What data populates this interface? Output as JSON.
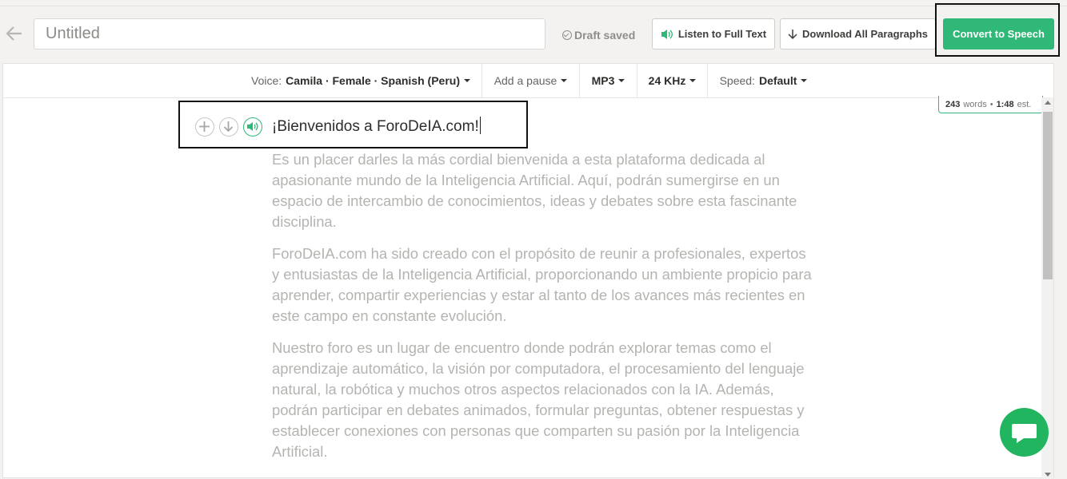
{
  "header": {
    "title_placeholder": "Untitled",
    "draft_status": "Draft saved",
    "listen_label": "Listen to Full Text",
    "download_label": "Download All Paragraphs",
    "convert_label": "Convert to Speech"
  },
  "toolbar": {
    "voice_label": "Voice:",
    "voice_value": "Camila · Female · Spanish (Peru)",
    "pause_label": "Add a pause",
    "format_value": "MP3",
    "rate_value": "24 KHz",
    "speed_label": "Speed:",
    "speed_value": "Default"
  },
  "stats": {
    "words": "243",
    "words_label": "words",
    "separator": "•",
    "duration": "1:48",
    "duration_label": "est."
  },
  "document": {
    "heading": "¡Bienvenidos a ForoDeIA.com!",
    "paragraphs": [
      "Es un placer darles la más cordial bienvenida a esta plataforma dedicada al apasionante mundo de la Inteligencia Artificial. Aquí, podrán sumergirse en un espacio de intercambio de conocimientos, ideas y debates sobre esta fascinante disciplina.",
      "ForoDeIA.com ha sido creado con el propósito de reunir a profesionales, expertos y entusiastas de la Inteligencia Artificial, proporcionando un ambiente propicio para aprender, compartir experiencias y estar al tanto de los avances más recientes en este campo en constante evolución.",
      "Nuestro foro es un lugar de encuentro donde podrán explorar temas como el aprendizaje automático, la visión por computadora, el procesamiento del lenguaje natural, la robótica y muchos otros aspectos relacionados con la IA. Además, podrán participar en debates animados, formular preguntas, obtener respuestas y establecer conexiones con personas que comparten su pasión por la Inteligencia Artificial."
    ]
  },
  "colors": {
    "accent": "#2fb877",
    "chat": "#20b55e"
  }
}
